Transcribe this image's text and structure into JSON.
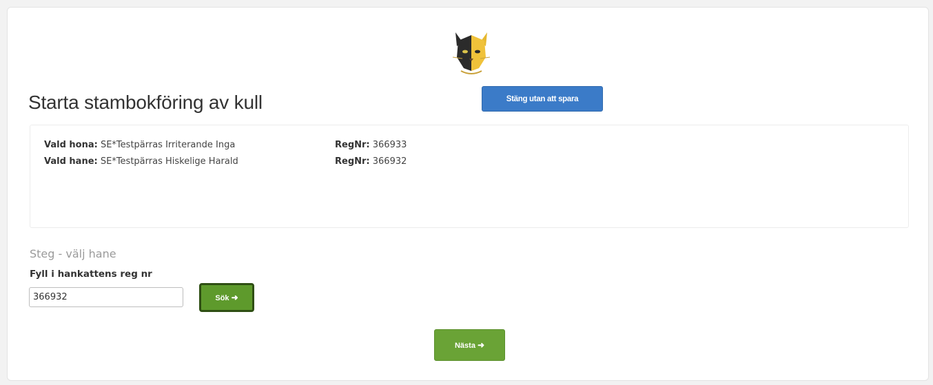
{
  "header": {
    "logo_icon": "cat-face-logo-icon",
    "title": "Starta stambokföring av kull",
    "close_button": "Stäng utan att spara"
  },
  "selection": {
    "hona": {
      "label": "Vald hona:",
      "name": "SE*Testpärras Irriterande Inga",
      "reg_label": "RegNr:",
      "reg_value": "366933"
    },
    "hane": {
      "label": "Vald hane:",
      "name": "SE*Testpärras Hiskelige Harald",
      "reg_label": "RegNr:",
      "reg_value": "366932"
    }
  },
  "step": {
    "title": "Steg - välj hane",
    "field_label": "Fyll i hankattens reg nr",
    "input_value": "366932",
    "search_button": "Sök",
    "next_button": "Nästa",
    "arrow_icon": "arrow-right-icon"
  },
  "colors": {
    "primary_blue": "#3b7bc8",
    "success_green": "#6aa336"
  }
}
